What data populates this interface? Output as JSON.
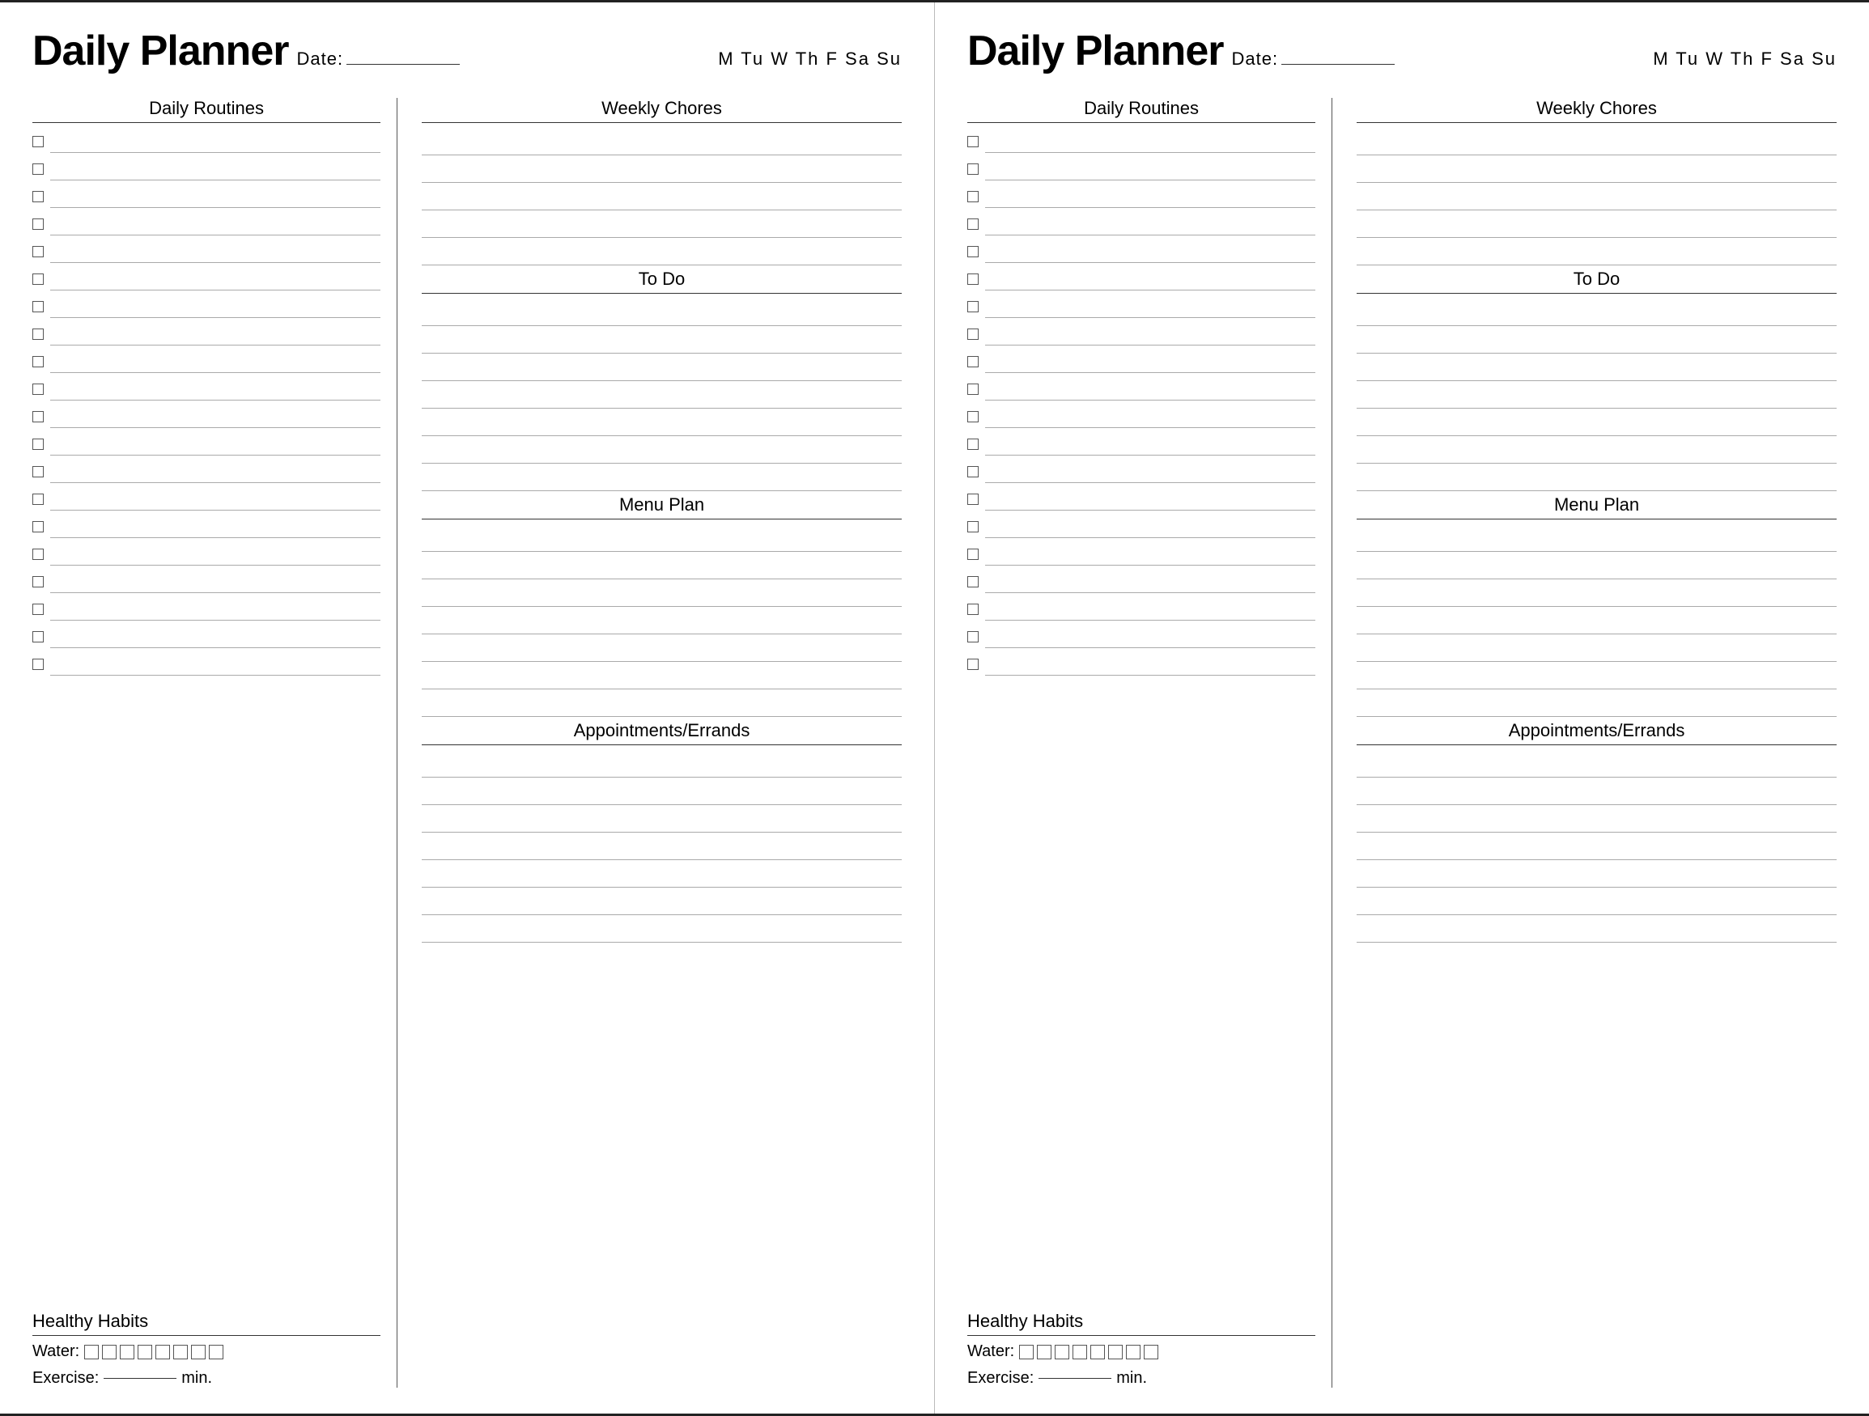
{
  "pages": [
    {
      "title": "Daily Planner",
      "date_label": "Date:",
      "days": "M  Tu  W  Th  F  Sa  Su",
      "left": {
        "daily_routines_label": "Daily Routines",
        "checkbox_count": 20
      },
      "right": {
        "weekly_chores_label": "Weekly Chores",
        "weekly_chores_lines": 5,
        "todo_label": "To Do",
        "todo_lines": 7,
        "menu_plan_label": "Menu Plan",
        "menu_plan_lines": 7,
        "appointments_label": "Appointments/Errands",
        "appointments_lines": 7
      },
      "healthy_habits": {
        "label": "Healthy Habits",
        "water_label": "Water:",
        "water_boxes": 8,
        "exercise_label": "Exercise:",
        "exercise_suffix": "min."
      }
    },
    {
      "title": "Daily Planner",
      "date_label": "Date:",
      "days": "M  Tu  W  Th  F  Sa  Su",
      "left": {
        "daily_routines_label": "Daily Routines",
        "checkbox_count": 20
      },
      "right": {
        "weekly_chores_label": "Weekly Chores",
        "weekly_chores_lines": 5,
        "todo_label": "To Do",
        "todo_lines": 7,
        "menu_plan_label": "Menu Plan",
        "menu_plan_lines": 7,
        "appointments_label": "Appointments/Errands",
        "appointments_lines": 7
      },
      "healthy_habits": {
        "label": "Healthy Habits",
        "water_label": "Water:",
        "water_boxes": 8,
        "exercise_label": "Exercise:",
        "exercise_suffix": "min."
      }
    }
  ]
}
